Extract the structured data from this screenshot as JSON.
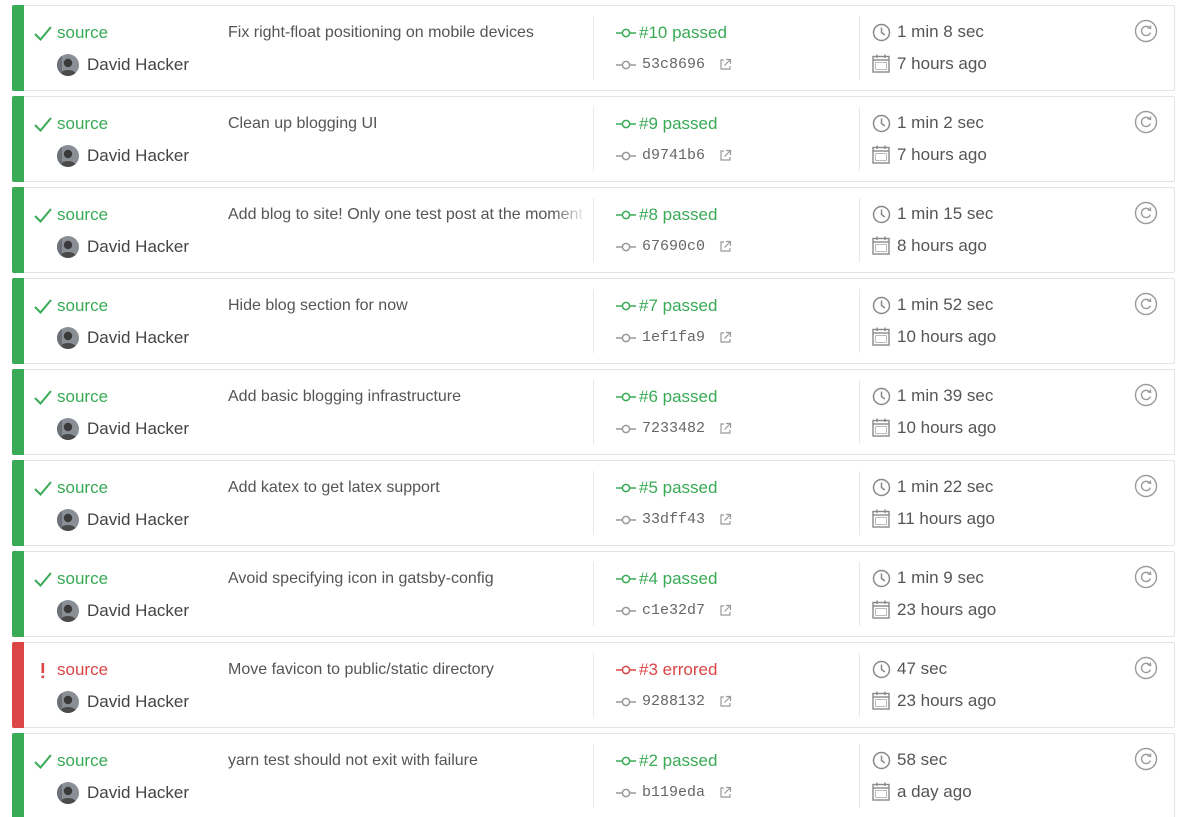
{
  "colors": {
    "passed": "#39aa56",
    "errored": "#db4545"
  },
  "builds": [
    {
      "state": "passed",
      "status_icon": "check-icon",
      "branch": "source",
      "author": "David Hacker",
      "message": "Fix right-float positioning on mobile devices",
      "build_label": "#10 passed",
      "commit": "53c8696",
      "duration": "1 min 8 sec",
      "finished": "7 hours ago"
    },
    {
      "state": "passed",
      "status_icon": "check-icon",
      "branch": "source",
      "author": "David Hacker",
      "message": "Clean up blogging UI",
      "build_label": "#9 passed",
      "commit": "d9741b6",
      "duration": "1 min 2 sec",
      "finished": "7 hours ago"
    },
    {
      "state": "passed",
      "status_icon": "check-icon",
      "branch": "source",
      "author": "David Hacker",
      "message": "Add blog to site! Only one test post at the moment",
      "build_label": "#8 passed",
      "commit": "67690c0",
      "duration": "1 min 15 sec",
      "finished": "8 hours ago"
    },
    {
      "state": "passed",
      "status_icon": "check-icon",
      "branch": "source",
      "author": "David Hacker",
      "message": "Hide blog section for now",
      "build_label": "#7 passed",
      "commit": "1ef1fa9",
      "duration": "1 min 52 sec",
      "finished": "10 hours ago"
    },
    {
      "state": "passed",
      "status_icon": "check-icon",
      "branch": "source",
      "author": "David Hacker",
      "message": "Add basic blogging infrastructure",
      "build_label": "#6 passed",
      "commit": "7233482",
      "duration": "1 min 39 sec",
      "finished": "10 hours ago"
    },
    {
      "state": "passed",
      "status_icon": "check-icon",
      "branch": "source",
      "author": "David Hacker",
      "message": "Add katex to get latex support",
      "build_label": "#5 passed",
      "commit": "33dff43",
      "duration": "1 min 22 sec",
      "finished": "11 hours ago"
    },
    {
      "state": "passed",
      "status_icon": "check-icon",
      "branch": "source",
      "author": "David Hacker",
      "message": "Avoid specifying icon in gatsby-config",
      "build_label": "#4 passed",
      "commit": "c1e32d7",
      "duration": "1 min 9 sec",
      "finished": "23 hours ago"
    },
    {
      "state": "errored",
      "status_icon": "exclamation-icon",
      "branch": "source",
      "author": "David Hacker",
      "message": "Move favicon to public/static directory",
      "build_label": "#3 errored",
      "commit": "9288132",
      "duration": "47 sec",
      "finished": "23 hours ago"
    },
    {
      "state": "passed",
      "status_icon": "check-icon",
      "branch": "source",
      "author": "David Hacker",
      "message": "yarn test should not exit with failure",
      "build_label": "#2 passed",
      "commit": "b119eda",
      "duration": "58 sec",
      "finished": "a day ago"
    }
  ]
}
